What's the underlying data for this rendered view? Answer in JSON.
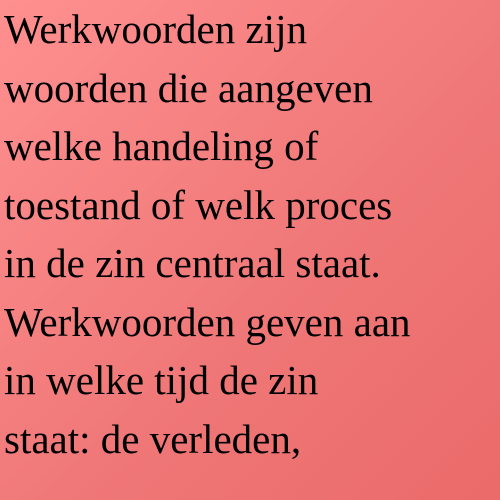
{
  "document": {
    "lines": [
      "Werkwoorden zijn",
      "woorden die aangeven",
      "welke handeling of",
      "toestand of welk proces",
      "in de zin centraal staat.",
      "Werkwoorden geven aan",
      "in welke tijd de zin",
      "staat: de verleden,"
    ]
  },
  "colors": {
    "background_start": "#ff9090",
    "background_end": "#eb6a6a",
    "text": "#000000"
  }
}
